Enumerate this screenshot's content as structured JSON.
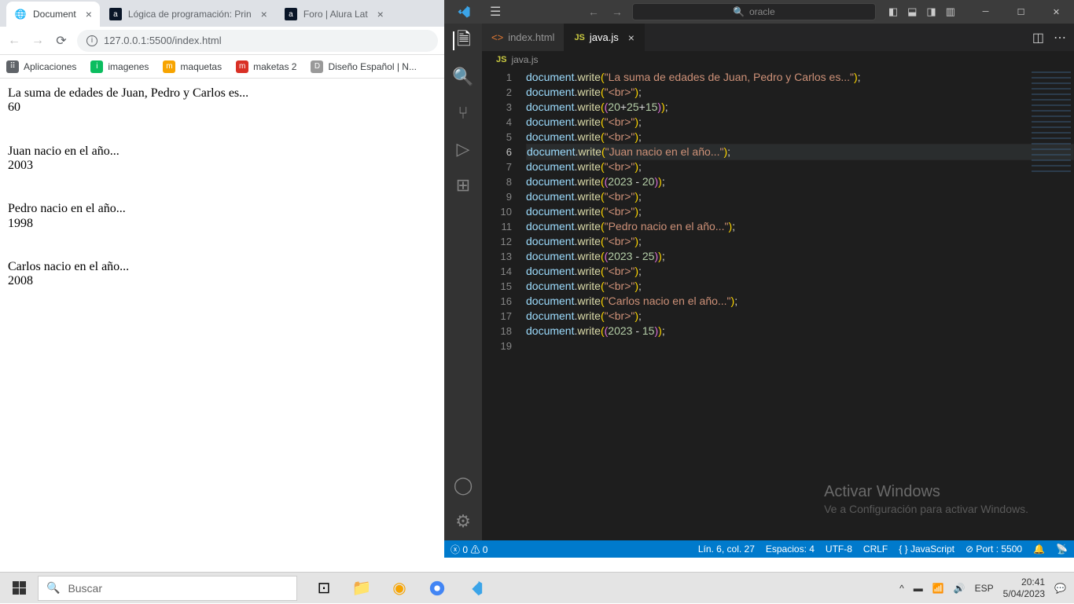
{
  "chrome": {
    "tabs": [
      {
        "title": "Document",
        "active": true
      },
      {
        "title": "Lógica de programación: Prin",
        "active": false
      },
      {
        "title": "Foro | Alura Lat",
        "active": false
      }
    ],
    "url": "127.0.0.1:5500/index.html",
    "bookmarks": [
      {
        "label": "Aplicaciones"
      },
      {
        "label": "imagenes"
      },
      {
        "label": "maquetas"
      },
      {
        "label": "maketas 2"
      },
      {
        "label": "Diseño Español | N..."
      }
    ],
    "page_lines": [
      "La suma de edades de Juan, Pedro y Carlos es...",
      "60",
      "",
      "Juan nacio en el año...",
      "2003",
      "",
      "Pedro nacio en el año...",
      "1998",
      "",
      "Carlos nacio en el año...",
      "2008"
    ]
  },
  "vscode": {
    "search_placeholder": "oracle",
    "tabs": [
      {
        "label": "index.html",
        "icon": "html",
        "active": false
      },
      {
        "label": "java.js",
        "icon": "js",
        "active": true
      }
    ],
    "breadcrumb": "java.js",
    "line_count": 19,
    "active_line": 6,
    "code": [
      [
        [
          "obj",
          "document"
        ],
        [
          "p",
          "."
        ],
        [
          "fn",
          "write"
        ],
        [
          "br",
          "("
        ],
        [
          "str",
          "\"La suma de edades de Juan, Pedro y Carlos es...\""
        ],
        [
          "br",
          ")"
        ],
        [
          "p",
          ";"
        ]
      ],
      [
        [
          "obj",
          "document"
        ],
        [
          "p",
          "."
        ],
        [
          "fn",
          "write"
        ],
        [
          "br",
          "("
        ],
        [
          "str",
          "\"<br>\""
        ],
        [
          "br",
          ")"
        ],
        [
          "p",
          ";"
        ]
      ],
      [
        [
          "obj",
          "document"
        ],
        [
          "p",
          "."
        ],
        [
          "fn",
          "write"
        ],
        [
          "br",
          "("
        ],
        [
          "br2",
          "("
        ],
        [
          "num",
          "20"
        ],
        [
          "p",
          "+"
        ],
        [
          "num",
          "25"
        ],
        [
          "p",
          "+"
        ],
        [
          "num",
          "15"
        ],
        [
          "br2",
          ")"
        ],
        [
          "br",
          ")"
        ],
        [
          "p",
          ";"
        ]
      ],
      [
        [
          "obj",
          "document"
        ],
        [
          "p",
          "."
        ],
        [
          "fn",
          "write"
        ],
        [
          "br",
          "("
        ],
        [
          "str",
          "\"<br>\""
        ],
        [
          "br",
          ")"
        ],
        [
          "p",
          ";"
        ]
      ],
      [
        [
          "obj",
          "document"
        ],
        [
          "p",
          "."
        ],
        [
          "fn",
          "write"
        ],
        [
          "br",
          "("
        ],
        [
          "str",
          "\"<br>\""
        ],
        [
          "br",
          ")"
        ],
        [
          "p",
          ";"
        ]
      ],
      [
        [
          "obj",
          "document"
        ],
        [
          "p",
          "."
        ],
        [
          "fn",
          "write"
        ],
        [
          "br",
          "("
        ],
        [
          "str",
          "\"Juan nacio en el año...\""
        ],
        [
          "br",
          ")"
        ],
        [
          "p",
          ";"
        ]
      ],
      [
        [
          "obj",
          "document"
        ],
        [
          "p",
          "."
        ],
        [
          "fn",
          "write"
        ],
        [
          "br",
          "("
        ],
        [
          "str",
          "\"<br>\""
        ],
        [
          "br",
          ")"
        ],
        [
          "p",
          ";"
        ]
      ],
      [
        [
          "obj",
          "document"
        ],
        [
          "p",
          "."
        ],
        [
          "fn",
          "write"
        ],
        [
          "br",
          "("
        ],
        [
          "br2",
          "("
        ],
        [
          "num",
          "2023"
        ],
        [
          "p",
          " - "
        ],
        [
          "num",
          "20"
        ],
        [
          "br2",
          ")"
        ],
        [
          "br",
          ")"
        ],
        [
          "p",
          ";"
        ]
      ],
      [
        [
          "obj",
          "document"
        ],
        [
          "p",
          "."
        ],
        [
          "fn",
          "write"
        ],
        [
          "br",
          "("
        ],
        [
          "str",
          "\"<br>\""
        ],
        [
          "br",
          ")"
        ],
        [
          "p",
          ";"
        ]
      ],
      [
        [
          "obj",
          "document"
        ],
        [
          "p",
          "."
        ],
        [
          "fn",
          "write"
        ],
        [
          "br",
          "("
        ],
        [
          "str",
          "\"<br>\""
        ],
        [
          "br",
          ")"
        ],
        [
          "p",
          ";"
        ]
      ],
      [
        [
          "obj",
          "document"
        ],
        [
          "p",
          "."
        ],
        [
          "fn",
          "write"
        ],
        [
          "br",
          "("
        ],
        [
          "str",
          "\"Pedro nacio en el año...\""
        ],
        [
          "br",
          ")"
        ],
        [
          "p",
          ";"
        ]
      ],
      [
        [
          "obj",
          "document"
        ],
        [
          "p",
          "."
        ],
        [
          "fn",
          "write"
        ],
        [
          "br",
          "("
        ],
        [
          "str",
          "\"<br>\""
        ],
        [
          "br",
          ")"
        ],
        [
          "p",
          ";"
        ]
      ],
      [
        [
          "obj",
          "document"
        ],
        [
          "p",
          "."
        ],
        [
          "fn",
          "write"
        ],
        [
          "br",
          "("
        ],
        [
          "br2",
          "("
        ],
        [
          "num",
          "2023"
        ],
        [
          "p",
          " - "
        ],
        [
          "num",
          "25"
        ],
        [
          "br2",
          ")"
        ],
        [
          "br",
          ")"
        ],
        [
          "p",
          ";"
        ]
      ],
      [
        [
          "obj",
          "document"
        ],
        [
          "p",
          "."
        ],
        [
          "fn",
          "write"
        ],
        [
          "br",
          "("
        ],
        [
          "str",
          "\"<br>\""
        ],
        [
          "br",
          ")"
        ],
        [
          "p",
          ";"
        ]
      ],
      [
        [
          "obj",
          "document"
        ],
        [
          "p",
          "."
        ],
        [
          "fn",
          "write"
        ],
        [
          "br",
          "("
        ],
        [
          "str",
          "\"<br>\""
        ],
        [
          "br",
          ")"
        ],
        [
          "p",
          ";"
        ]
      ],
      [
        [
          "obj",
          "document"
        ],
        [
          "p",
          "."
        ],
        [
          "fn",
          "write"
        ],
        [
          "br",
          "("
        ],
        [
          "str",
          "\"Carlos nacio en el año...\""
        ],
        [
          "br",
          ")"
        ],
        [
          "p",
          ";"
        ]
      ],
      [
        [
          "obj",
          "document"
        ],
        [
          "p",
          "."
        ],
        [
          "fn",
          "write"
        ],
        [
          "br",
          "("
        ],
        [
          "str",
          "\"<br>\""
        ],
        [
          "br",
          ")"
        ],
        [
          "p",
          ";"
        ]
      ],
      [
        [
          "obj",
          "document"
        ],
        [
          "p",
          "."
        ],
        [
          "fn",
          "write"
        ],
        [
          "br",
          "("
        ],
        [
          "br2",
          "("
        ],
        [
          "num",
          "2023"
        ],
        [
          "p",
          " - "
        ],
        [
          "num",
          "15"
        ],
        [
          "br2",
          ")"
        ],
        [
          "br",
          ")"
        ],
        [
          "p",
          ";"
        ]
      ],
      []
    ],
    "status": {
      "errors": "0",
      "warnings": "0",
      "position": "Lín. 6, col. 27",
      "spaces": "Espacios: 4",
      "encoding": "UTF-8",
      "eol": "CRLF",
      "lang": "{ } JavaScript",
      "port": "Port : 5500"
    },
    "watermark_title": "Activar Windows",
    "watermark_sub": "Ve a Configuración para activar Windows."
  },
  "taskbar": {
    "search_placeholder": "Buscar",
    "lang": "ESP",
    "time": "20:41",
    "date": "5/04/2023"
  }
}
